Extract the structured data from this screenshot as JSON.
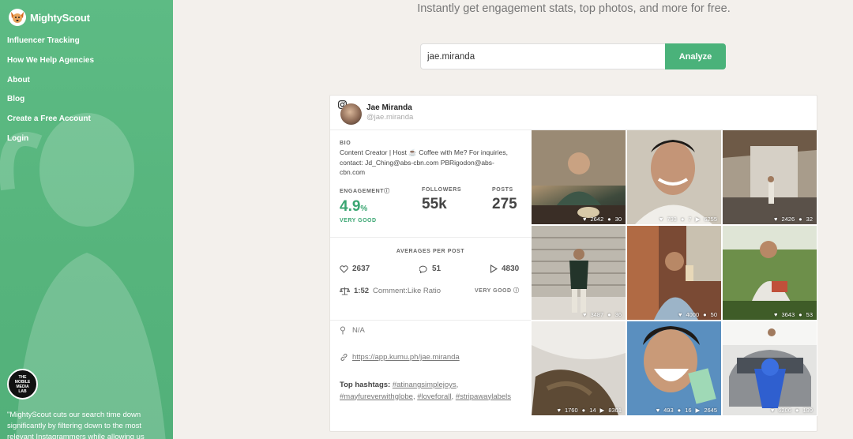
{
  "brand": {
    "name": "MightyScout"
  },
  "nav": [
    {
      "label": "Influencer Tracking"
    },
    {
      "label": "How We Help Agencies"
    },
    {
      "label": "About"
    },
    {
      "label": "Blog"
    },
    {
      "label": "Create a Free Account"
    },
    {
      "label": "Login"
    }
  ],
  "badge": {
    "line1": "THE",
    "line2": "MOBILE",
    "line3": "MEDIA",
    "line4": "LAB"
  },
  "testimonial": "\"MightyScout cuts our search time down significantly by filtering down to the most relevant Instagrammers while allowing us",
  "tagline": "Instantly get engagement stats, top photos, and more for free.",
  "search": {
    "value": "jae.miranda",
    "button": "Analyze"
  },
  "profile": {
    "name": "Jae Miranda",
    "handle": "@jae.miranda",
    "bio_label": "BIO",
    "bio": "Content Creator | Host ☕ Coffee with Me? For inquiries, contact: Jd_Ching@abs-cbn.com PBRigodon@abs-cbn.com",
    "engagement_label": "ENGAGEMENT",
    "engagement_value": "4.9",
    "engagement_unit": "%",
    "engagement_grade": "VERY GOOD",
    "followers_label": "FOLLOWERS",
    "followers_value": "55k",
    "posts_label": "POSTS",
    "posts_value": "275",
    "averages_label": "AVERAGES PER POST",
    "avg_likes": "2637",
    "avg_comments": "51",
    "avg_views": "4830",
    "ratio_value": "1:52",
    "ratio_label": "Comment:Like Ratio",
    "ratio_grade": "VERY GOOD",
    "location": "N/A",
    "link": "https://app.kumu.ph/jae.miranda",
    "hashtags_label": "Top hashtags:",
    "hashtags": [
      "#atinangsimplejoys",
      "#mayfureverwithglobe",
      "#loveforall",
      "#stripawaylabels"
    ]
  },
  "photos": [
    {
      "likes": "2642",
      "comments": "30",
      "views": ""
    },
    {
      "likes": "793",
      "comments": "7",
      "views": "6255"
    },
    {
      "likes": "2426",
      "comments": "32",
      "views": ""
    },
    {
      "likes": "3487",
      "comments": "36",
      "views": ""
    },
    {
      "likes": "4000",
      "comments": "50",
      "views": ""
    },
    {
      "likes": "3643",
      "comments": "53",
      "views": ""
    },
    {
      "likes": "1760",
      "comments": "14",
      "views": "8301"
    },
    {
      "likes": "493",
      "comments": "16",
      "views": "2645"
    },
    {
      "likes": "6206",
      "comments": "199",
      "views": ""
    }
  ]
}
